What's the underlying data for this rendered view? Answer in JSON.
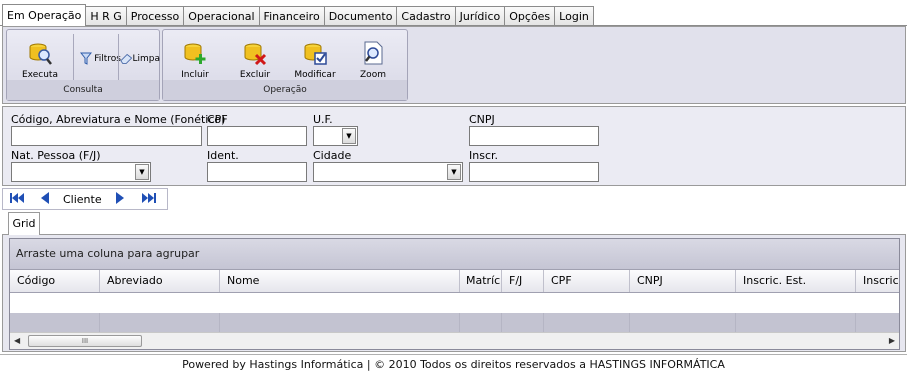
{
  "tabs": [
    "Em Operação",
    "H R G",
    "Processo",
    "Operacional",
    "Financeiro",
    "Documento",
    "Cadastro",
    "Jurídico",
    "Opções",
    "Login"
  ],
  "ribbon": {
    "consulta": {
      "title": "Consulta",
      "executa": "Executa",
      "filtros": "Filtros",
      "limpa": "Limpa"
    },
    "operacao": {
      "title": "Operação",
      "incluir": "Incluir",
      "excluir": "Excluir",
      "modificar": "Modificar",
      "zoom": "Zoom"
    }
  },
  "form": {
    "codigo_label": "Código, Abreviatura e Nome (Fonético)",
    "codigo_value": "",
    "cpf_label": "CPF",
    "cpf_value": "",
    "uf_label": "U.F.",
    "uf_value": "",
    "cnpj_label": "CNPJ",
    "cnpj_value": "",
    "natpessoa_label": "Nat. Pessoa (F/J)",
    "natpessoa_value": "",
    "ident_label": "Ident.",
    "ident_value": "",
    "cidade_label": "Cidade",
    "cidade_value": "",
    "inscr_label": "Inscr.",
    "inscr_value": ""
  },
  "navigator": {
    "label": "Cliente"
  },
  "grid": {
    "tab_label": "Grid",
    "group_hint": "Arraste uma coluna para agrupar",
    "columns": [
      "Código",
      "Abreviado",
      "Nome",
      "Matrícu",
      "F/J",
      "CPF",
      "CNPJ",
      "Inscric. Est.",
      "Inscric."
    ],
    "scroll_grip": "III"
  },
  "footer": {
    "text": "Powered by Hastings Informática  |  © 2010 Todos os direitos reservados a HASTINGS INFORMÁTICA"
  }
}
